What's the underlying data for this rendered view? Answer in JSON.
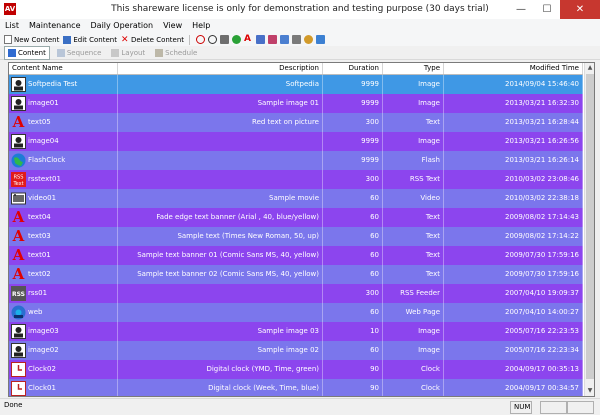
{
  "window": {
    "title": "This shareware license is only for demonstration and testing purpose (30 days trial)",
    "app_icon_text": "AV",
    "minimize": "—",
    "maximize": "☐",
    "close": "✕"
  },
  "menu": [
    "List",
    "Maintenance",
    "Daily Operation",
    "View",
    "Help"
  ],
  "toolbar": {
    "new_label": "New Content",
    "edit_label": "Edit Content",
    "delete_label": "Delete Content"
  },
  "tabs": [
    {
      "label": "Content",
      "active": true
    },
    {
      "label": "Sequence",
      "active": false
    },
    {
      "label": "Layout",
      "active": false
    },
    {
      "label": "Schedule",
      "active": false
    }
  ],
  "columns": [
    "Content Name",
    "Description",
    "Duration",
    "Type",
    "Modified Time"
  ],
  "rows": [
    {
      "name": "Softpedia Test",
      "desc": "Softpedia",
      "dur": "9999",
      "type": "Image",
      "time": "2014/09/04 15:46:40",
      "icon": "image-icon",
      "selected": true
    },
    {
      "name": "image01",
      "desc": "Sample image 01",
      "dur": "9999",
      "type": "Image",
      "time": "2013/03/21 16:32:30",
      "icon": "image-icon"
    },
    {
      "name": "text05",
      "desc": "Red text on picture",
      "dur": "300",
      "type": "Text",
      "time": "2013/03/21 16:28:44",
      "icon": "text-icon"
    },
    {
      "name": "image04",
      "desc": "",
      "dur": "9999",
      "type": "Image",
      "time": "2013/03/21 16:26:56",
      "icon": "image-icon"
    },
    {
      "name": "FlashClock",
      "desc": "",
      "dur": "9999",
      "type": "Flash",
      "time": "2013/03/21 16:26:14",
      "icon": "globe-icon"
    },
    {
      "name": "rsstext01",
      "desc": "",
      "dur": "300",
      "type": "RSS Text",
      "time": "2010/03/02 23:08:46",
      "icon": "rss-text-icon"
    },
    {
      "name": "video01",
      "desc": "Sample movie",
      "dur": "60",
      "type": "Video",
      "time": "2010/03/02 22:38:18",
      "icon": "video-icon"
    },
    {
      "name": "text04",
      "desc": "Fade edge text banner (Arial , 40, blue/yellow)",
      "dur": "60",
      "type": "Text",
      "time": "2009/08/02 17:14:43",
      "icon": "text-icon"
    },
    {
      "name": "text03",
      "desc": "Sample text (Times New Roman, 50, up)",
      "dur": "60",
      "type": "Text",
      "time": "2009/08/02 17:14:22",
      "icon": "text-icon"
    },
    {
      "name": "text01",
      "desc": "Sample text banner 01 (Comic Sans MS, 40, yellow)",
      "dur": "60",
      "type": "Text",
      "time": "2009/07/30 17:59:16",
      "icon": "text-icon"
    },
    {
      "name": "text02",
      "desc": "Sample text banner 02 (Comic Sans MS, 40, yellow)",
      "dur": "60",
      "type": "Text",
      "time": "2009/07/30 17:59:16",
      "icon": "text-icon"
    },
    {
      "name": "rss01",
      "desc": "",
      "dur": "300",
      "type": "RSS Feeder",
      "time": "2007/04/10 19:09:37",
      "icon": "rss-icon"
    },
    {
      "name": "web",
      "desc": "",
      "dur": "60",
      "type": "Web Page",
      "time": "2007/04/10 14:00:27",
      "icon": "web-icon"
    },
    {
      "name": "image03",
      "desc": "Sample image 03",
      "dur": "10",
      "type": "Image",
      "time": "2005/07/16 22:23:53",
      "icon": "image-icon"
    },
    {
      "name": "image02",
      "desc": "Sample image 02",
      "dur": "60",
      "type": "Image",
      "time": "2005/07/16 22:23:34",
      "icon": "image-icon"
    },
    {
      "name": "Clock02",
      "desc": "Digital clock (YMD, Time, green)",
      "dur": "90",
      "type": "Clock",
      "time": "2004/09/17 00:35:13",
      "icon": "clock-icon"
    },
    {
      "name": "Clock01",
      "desc": "Digital clock (Week, Time, blue)",
      "dur": "90",
      "type": "Clock",
      "time": "2004/09/17 00:34:57",
      "icon": "clock-icon"
    }
  ],
  "colors": {
    "row_a": "#7b76ec",
    "row_b": "#8c45ee",
    "selected": "#3f98e5"
  },
  "status": {
    "text": "Done",
    "num": "NUM"
  }
}
